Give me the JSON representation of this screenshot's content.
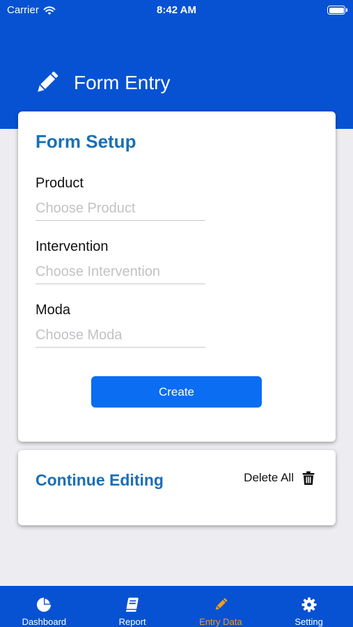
{
  "status_bar": {
    "carrier": "Carrier",
    "time": "8:42 AM"
  },
  "header": {
    "title": "Form Entry",
    "icon": "pencil-icon"
  },
  "form_setup": {
    "heading": "Form Setup",
    "fields": [
      {
        "label": "Product",
        "placeholder": "Choose Product",
        "value": ""
      },
      {
        "label": "Intervention",
        "placeholder": "Choose Intervention",
        "value": ""
      },
      {
        "label": "Moda",
        "placeholder": "Choose Moda",
        "value": ""
      }
    ],
    "create_label": "Create"
  },
  "continue_editing": {
    "heading": "Continue Editing",
    "delete_all_label": "Delete All",
    "delete_icon": "trash-icon"
  },
  "tabbar": {
    "tabs": [
      {
        "label": "Dashboard",
        "icon": "pie-chart-icon"
      },
      {
        "label": "Report",
        "icon": "book-icon"
      },
      {
        "label": "Entry Data",
        "icon": "pencil-icon"
      },
      {
        "label": "Setting",
        "icon": "gear-icon"
      }
    ],
    "active_tab": "Entry Data"
  },
  "colors": {
    "primary": "#0652d3",
    "heading": "#1a6fb4",
    "button": "#0a6df2",
    "active_tab": "#f29c1e",
    "background": "#ececf1"
  }
}
